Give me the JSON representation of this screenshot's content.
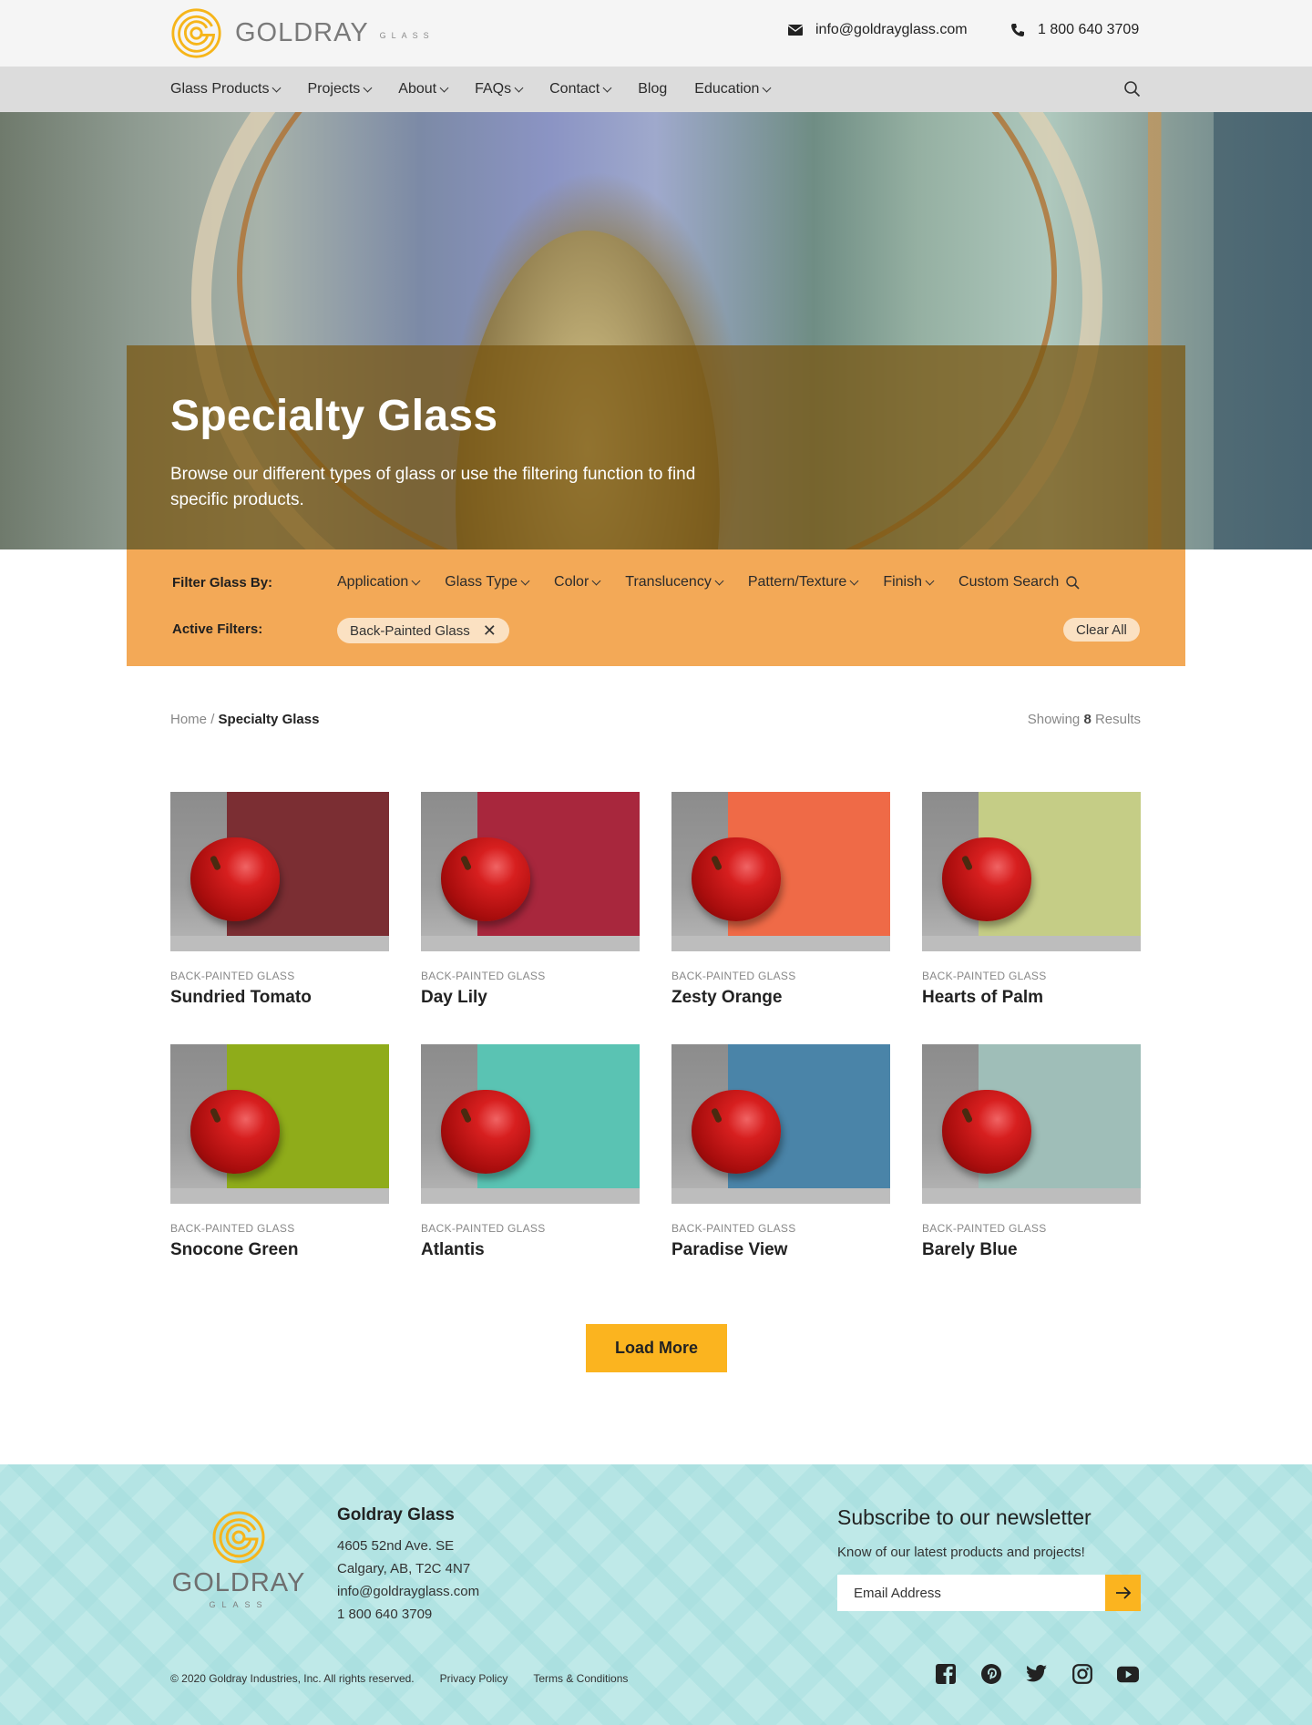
{
  "brand": {
    "name": "GOLDRAY",
    "sub": "GLASS",
    "accent": "#f6b51a"
  },
  "contact": {
    "email": "info@goldrayglass.com",
    "phone": "1 800 640 3709"
  },
  "nav": {
    "items": [
      {
        "label": "Glass Products",
        "dropdown": true
      },
      {
        "label": "Projects",
        "dropdown": true
      },
      {
        "label": "About",
        "dropdown": true
      },
      {
        "label": "FAQs",
        "dropdown": true
      },
      {
        "label": "Contact",
        "dropdown": true
      },
      {
        "label": "Blog",
        "dropdown": false
      },
      {
        "label": "Education",
        "dropdown": true
      }
    ]
  },
  "hero": {
    "title": "Specialty Glass",
    "subtitle": "Browse our different types of glass or use the filtering function to find specific products."
  },
  "filters": {
    "filter_label": "Filter Glass By:",
    "active_label": "Active Filters:",
    "items": [
      "Application",
      "Glass Type",
      "Color",
      "Translucency",
      "Pattern/Texture",
      "Finish"
    ],
    "custom_search": "Custom Search",
    "active": [
      "Back-Painted Glass"
    ],
    "clear_all": "Clear All",
    "bar_color": "#f3a957"
  },
  "breadcrumb": {
    "home": "Home",
    "separator": "/",
    "current": "Specialty Glass"
  },
  "results": {
    "prefix": "Showing",
    "count": "8",
    "suffix": "Results"
  },
  "products": [
    {
      "category": "Back-Painted Glass",
      "name": "Sundried Tomato",
      "color": "#7b2e33"
    },
    {
      "category": "Back-Painted Glass",
      "name": "Day Lily",
      "color": "#a8273d"
    },
    {
      "category": "Back-Painted Glass",
      "name": "Zesty Orange",
      "color": "#ef6a47"
    },
    {
      "category": "Back-Painted Glass",
      "name": "Hearts of Palm",
      "color": "#c5cd86"
    },
    {
      "category": "Back-Painted Glass",
      "name": "Snocone Green",
      "color": "#8fac1a"
    },
    {
      "category": "Back-Painted Glass",
      "name": "Atlantis",
      "color": "#5ac3b3"
    },
    {
      "category": "Back-Painted Glass",
      "name": "Paradise View",
      "color": "#4a84a8"
    },
    {
      "category": "Back-Painted Glass",
      "name": "Barely Blue",
      "color": "#9fbeb8"
    }
  ],
  "load_more": "Load More",
  "footer": {
    "company": "Goldray Glass",
    "address_1": "4605 52nd Ave. SE",
    "address_2": "Calgary, AB, T2C 4N7",
    "email": "info@goldrayglass.com",
    "phone": "1 800 640 3709",
    "newsletter_title": "Subscribe to our newsletter",
    "newsletter_desc": "Know of our latest products and projects!",
    "newsletter_placeholder": "Email Address",
    "copyright": "© 2020 Goldray Industries, Inc. All rights reserved.",
    "privacy": "Privacy Policy",
    "terms": "Terms & Conditions",
    "social": [
      "facebook-icon",
      "pinterest-icon",
      "twitter-icon",
      "instagram-icon",
      "youtube-icon"
    ]
  }
}
